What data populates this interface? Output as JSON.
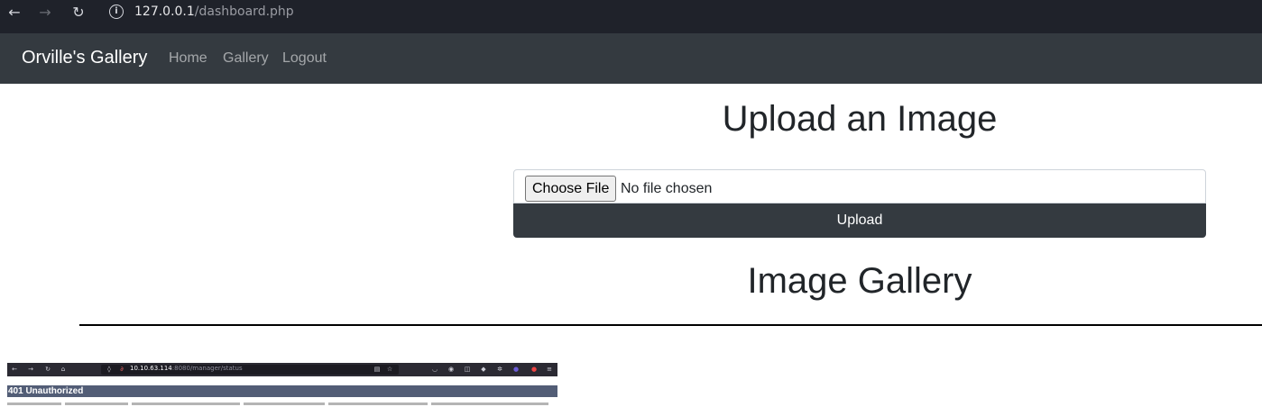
{
  "browser": {
    "url_host": "127.0.0.1",
    "url_path": "/dashboard.php"
  },
  "navbar": {
    "brand": "Orville's Gallery",
    "links": [
      "Home",
      "Gallery",
      "Logout"
    ]
  },
  "upload": {
    "title": "Upload an Image",
    "choose_label": "Choose File",
    "no_file_text": "No file chosen",
    "button_label": "Upload"
  },
  "gallery": {
    "title": "Image Gallery",
    "thumbnail": {
      "url_host": "10.10.63.114",
      "url_rest": ":8080/manager/status",
      "heading": "401 Unauthorized"
    }
  },
  "colors": {
    "navbar_bg": "#343a40",
    "button_bg": "#343a40",
    "chrome_bg": "#1f222a"
  }
}
